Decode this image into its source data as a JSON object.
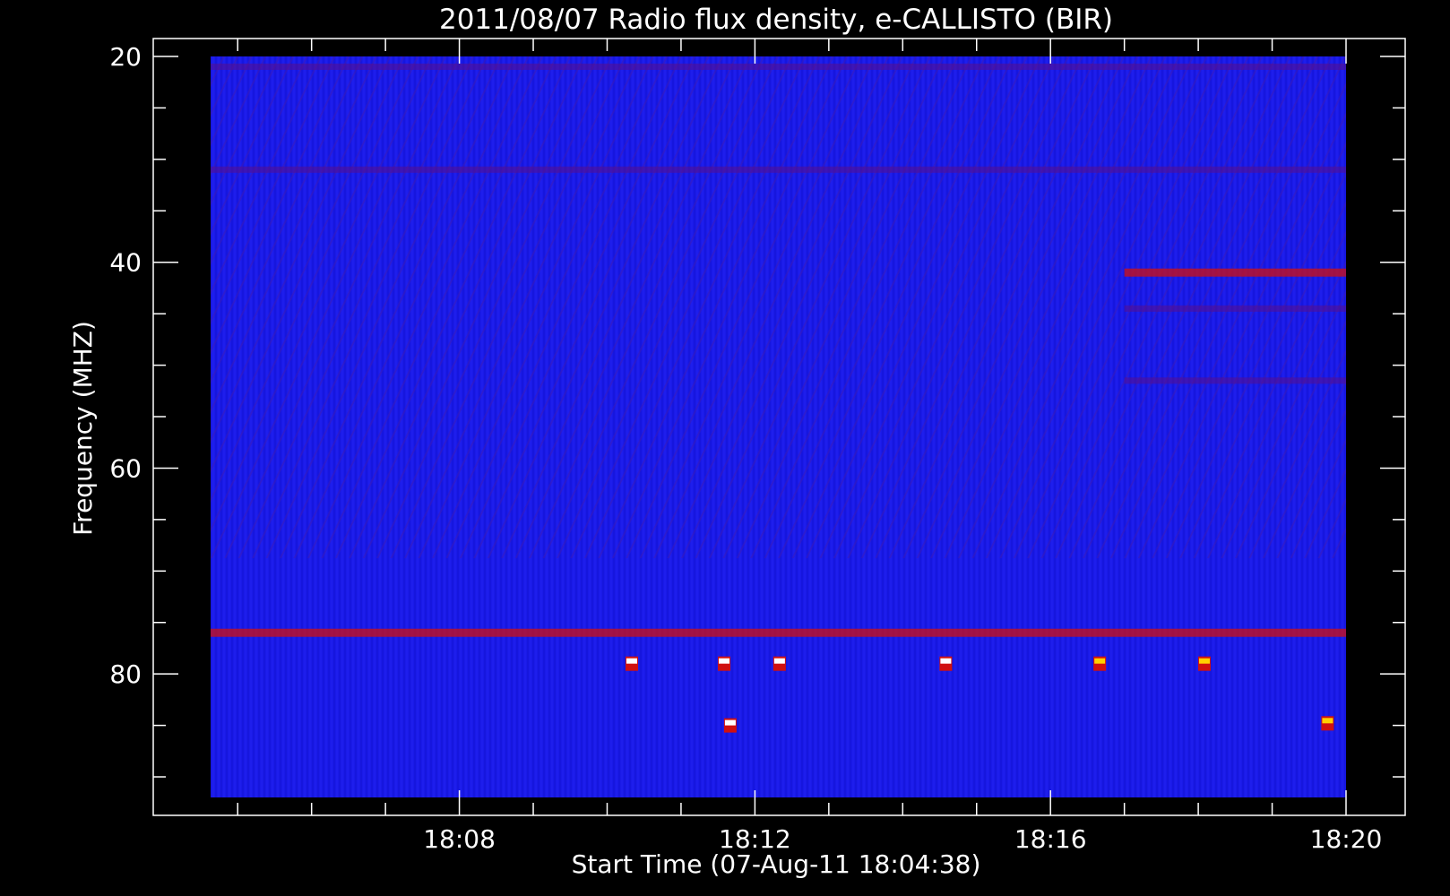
{
  "chart_data": {
    "type": "heatmap",
    "title": "2011/08/07  Radio flux density, e-CALLISTO (BIR)",
    "xlabel": "Start Time (07-Aug-11 18:04:38)",
    "ylabel": "Frequency (MHZ)",
    "x_range_minutes": [
      "18:04:38",
      "18:20:00"
    ],
    "y_range_mhz": [
      20,
      92
    ],
    "y_inverted": true,
    "x_ticks": [
      "18:08",
      "18:12",
      "18:16",
      "18:20"
    ],
    "y_ticks": [
      "20",
      "40",
      "60",
      "80"
    ],
    "grid": false,
    "colormap": "blue-red-yellow-white",
    "colors": {
      "background": "#000000",
      "base": "#1a1ae8",
      "low": "#5a0f8a",
      "mid": "#d01010",
      "high": "#ffd000",
      "peak": "#ffffff"
    },
    "features": [
      {
        "kind": "band",
        "freq_mhz": 41,
        "start_time": "18:17:00",
        "end_time": "18:20:00",
        "intensity": "high"
      },
      {
        "kind": "band",
        "freq_mhz": 44.5,
        "start_time": "18:17:00",
        "end_time": "18:20:00",
        "intensity": "medium"
      },
      {
        "kind": "band",
        "freq_mhz": 51.5,
        "start_time": "18:17:00",
        "end_time": "18:20:00",
        "intensity": "medium"
      },
      {
        "kind": "band",
        "freq_mhz": 76,
        "start_time": "18:04:38",
        "end_time": "18:20:00",
        "intensity": "high"
      },
      {
        "kind": "band",
        "freq_mhz": 21,
        "start_time": "18:04:38",
        "end_time": "18:20:00",
        "intensity": "medium"
      },
      {
        "kind": "band",
        "freq_mhz": 31,
        "start_time": "18:04:38",
        "end_time": "18:20:00",
        "intensity": "medium"
      },
      {
        "kind": "spot",
        "time": "18:10:20",
        "freq_mhz": 79,
        "intensity": "peak"
      },
      {
        "kind": "spot",
        "time": "18:11:35",
        "freq_mhz": 79,
        "intensity": "peak"
      },
      {
        "kind": "spot",
        "time": "18:12:20",
        "freq_mhz": 79,
        "intensity": "peak"
      },
      {
        "kind": "spot",
        "time": "18:14:35",
        "freq_mhz": 79,
        "intensity": "peak"
      },
      {
        "kind": "spot",
        "time": "18:16:40",
        "freq_mhz": 79,
        "intensity": "high"
      },
      {
        "kind": "spot",
        "time": "18:18:05",
        "freq_mhz": 79,
        "intensity": "high"
      },
      {
        "kind": "spot",
        "time": "18:11:40",
        "freq_mhz": 85,
        "intensity": "peak"
      },
      {
        "kind": "spot",
        "time": "18:19:45",
        "freq_mhz": 84.8,
        "intensity": "high"
      }
    ]
  }
}
